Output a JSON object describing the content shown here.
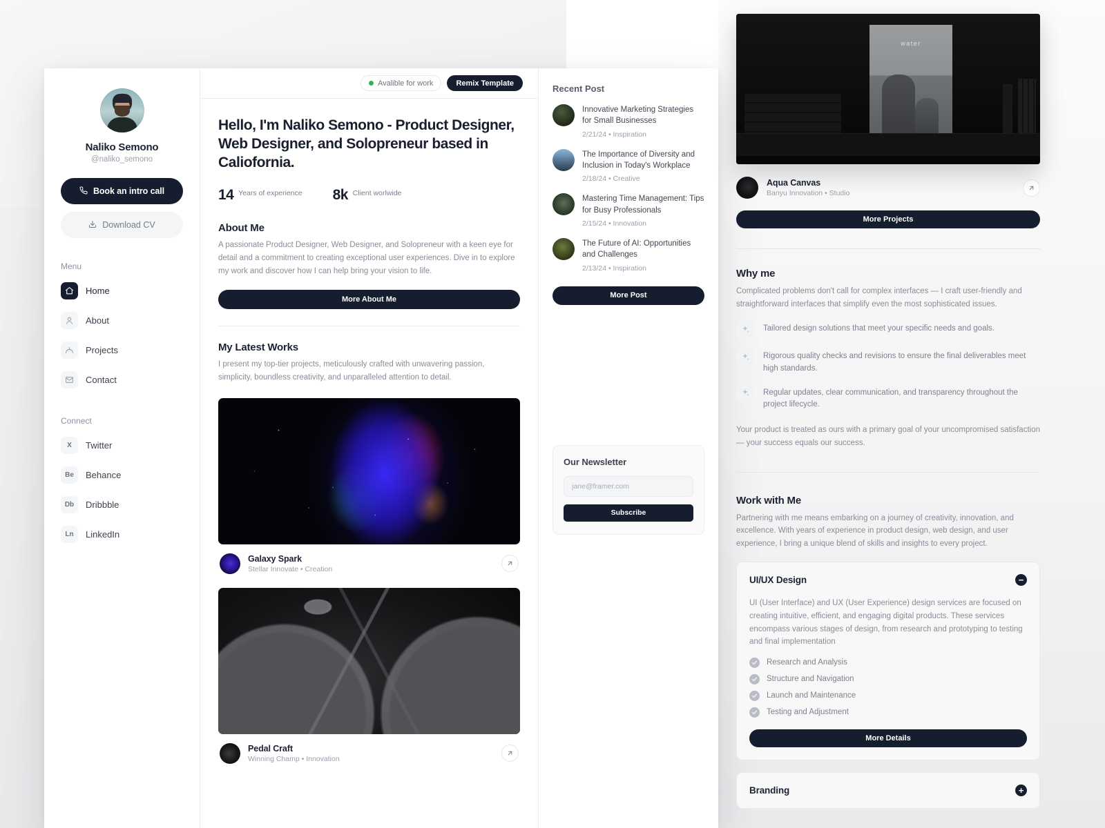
{
  "sidebar": {
    "name": "Naliko Semono",
    "handle": "@naliko_semono",
    "cta_primary": "Book an intro call",
    "cta_secondary": "Download CV",
    "menu_label": "Menu",
    "menu_items": [
      {
        "label": "Home",
        "icon": "home-icon",
        "active": true
      },
      {
        "label": "About",
        "icon": "user-icon",
        "active": false
      },
      {
        "label": "Projects",
        "icon": "projects-icon",
        "active": false
      },
      {
        "label": "Contact",
        "icon": "mail-icon",
        "active": false
      }
    ],
    "connect_label": "Connect",
    "connect_items": [
      {
        "label": "Twitter",
        "mark": "X"
      },
      {
        "label": "Behance",
        "mark": "Be"
      },
      {
        "label": "Dribbble",
        "mark": "Db"
      },
      {
        "label": "LinkedIn",
        "mark": "Ln"
      }
    ]
  },
  "topbar": {
    "available_badge": "Avalible for work",
    "remix_button": "Remix Template",
    "status_color": "#2fb457"
  },
  "hero": {
    "title": "Hello, I'm Naliko Semono - Product Designer, Web Designer, and Solopreneur based in Caliofornia.",
    "stats": [
      {
        "value": "14",
        "label": "Years of experience"
      },
      {
        "value": "8k",
        "label": "Client worlwide"
      }
    ]
  },
  "about": {
    "title": "About Me",
    "body": "A passionate Product Designer, Web Designer, and Solopreneur with a keen eye for detail and a commitment to creating exceptional user experiences. Dive in to explore my work and discover how I can help bring your vision to life.",
    "button": "More About Me"
  },
  "works": {
    "title": "My Latest Works",
    "body": "I present my top-tier projects, meticulously crafted with unwavering passion, simplicity, boundless creativity, and unparalleled attention to detail.",
    "items": [
      {
        "name": "Galaxy Spark",
        "sub": "Stellar Innovate  •  Creation"
      },
      {
        "name": "Pedal Craft",
        "sub": "Winning Champ  •  Innovation"
      }
    ]
  },
  "posts": {
    "title": "Recent Post",
    "items": [
      {
        "title": "Innovative Marketing Strategies for Small Businesses",
        "meta": "2/21/24  •  Inspiration"
      },
      {
        "title": "The Importance of Diversity and Inclusion in Today's Workplace",
        "meta": "2/18/24  •  Creative"
      },
      {
        "title": "Mastering Time Management: Tips for Busy Professionals",
        "meta": "2/15/24  •  Innovation"
      },
      {
        "title": "The Future of AI: Opportunities and Challenges",
        "meta": "2/13/24  •  Inspiration"
      }
    ],
    "button": "More Post"
  },
  "newsletter": {
    "title": "Our Newsletter",
    "placeholder": "jane@framer.com",
    "value": "",
    "button": "Subscribe"
  },
  "featured_project": {
    "name": "Aqua Canvas",
    "sub": "Banyu Innovation  •  Studio",
    "poster_word": "water",
    "button": "More Projects"
  },
  "why_me": {
    "title": "Why me",
    "intro": "Complicated problems don't call for complex interfaces — I craft user-friendly and straightforward interfaces that simplify even the most sophisticated issues.",
    "features": [
      "Tailored design solutions that meet your specific needs and goals.",
      "Rigorous quality checks and revisions to ensure the final deliverables meet high standards.",
      "Regular updates, clear communication, and transparency throughout the project lifecycle."
    ],
    "outro": "Your product is treated as ours with a primary goal of your uncompromised satisfaction — your success equals our success."
  },
  "work_with_me": {
    "title": "Work with Me",
    "intro": "Partnering with me means embarking on a journey of creativity, innovation, and excellence. With years of experience in product design, web design, and user experience, I bring a unique blend of skills and insights to every project.",
    "accordions": [
      {
        "title": "UI/UX Design",
        "toggle": "−",
        "body": "UI (User Interface) and UX (User Experience) design services are focused on creating intuitive, efficient, and engaging digital products. These services encompass various stages of design, from research and prototyping to testing and final implementation",
        "items": [
          "Research and Analysis",
          "Structure and Navigation",
          "Launch and Maintenance",
          "Testing and Adjustment"
        ],
        "button": "More Details"
      },
      {
        "title": "Branding",
        "toggle": "+"
      }
    ]
  },
  "theme": {
    "ink": "#161d2e",
    "muted": "#878d98",
    "accent_green": "#2fb457"
  }
}
